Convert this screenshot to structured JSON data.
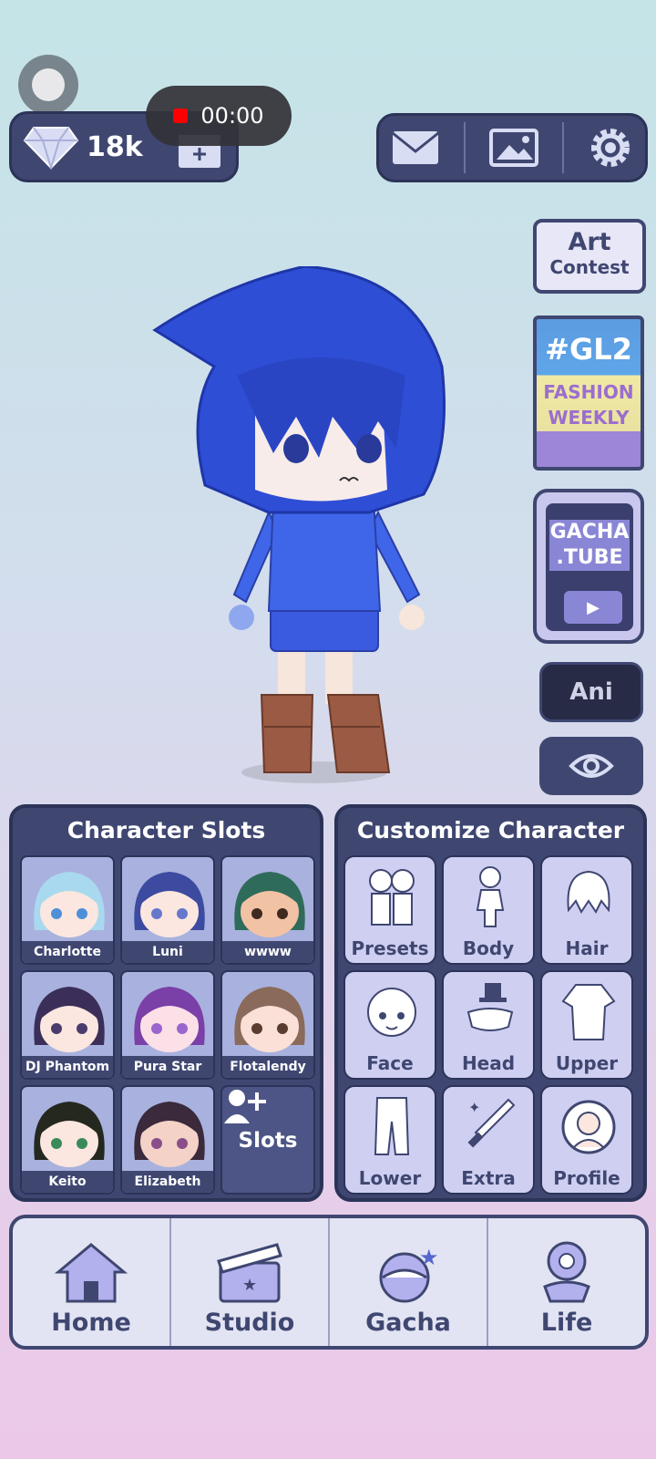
{
  "status": {
    "recording_time": "00:00"
  },
  "currency": {
    "gems": "18k"
  },
  "promos": {
    "art_contest_line1": "Art",
    "art_contest_line2": "Contest",
    "gl2_tag": "#GL2",
    "gl2_line1": "FASHION",
    "gl2_line2": "WEEKLY",
    "gachatube_line1": "GACHA",
    "gachatube_line2": ".TUBE"
  },
  "controls": {
    "ani_label": "Ani"
  },
  "slots_panel": {
    "title": "Character Slots",
    "slots": [
      {
        "name": "Charlotte",
        "hair": "#a9d9ef",
        "skin": "#fbe7df",
        "eyes": "#4f8fd8"
      },
      {
        "name": "Luni",
        "hair": "#3c4aa0",
        "skin": "#fbe7df",
        "eyes": "#6677cc"
      },
      {
        "name": "wwww",
        "hair": "#2f6b5a",
        "skin": "#f2c2a4",
        "eyes": "#3f2a20"
      },
      {
        "name": "DJ Phantom",
        "hair": "#3b2f59",
        "skin": "#fbe7df",
        "eyes": "#4a3b6e"
      },
      {
        "name": "Pura Star",
        "hair": "#7b3fa8",
        "skin": "#fbe0e8",
        "eyes": "#9a65cc"
      },
      {
        "name": "Flotalendy",
        "hair": "#8a6a5a",
        "skin": "#fbe0d8",
        "eyes": "#5a3c30"
      },
      {
        "name": "Keito",
        "hair": "#24281f",
        "skin": "#fbe7df",
        "eyes": "#3a8a5a"
      },
      {
        "name": "Elizabeth",
        "hair": "#3a2a3c",
        "skin": "#f4d2c8",
        "eyes": "#8a4f8a"
      }
    ],
    "add_label": "Slots"
  },
  "customize_panel": {
    "title": "Customize Character",
    "buttons": [
      "Presets",
      "Body",
      "Hair",
      "Face",
      "Head",
      "Upper",
      "Lower",
      "Extra",
      "Profile"
    ]
  },
  "bottom_nav": [
    "Home",
    "Studio",
    "Gacha",
    "Life"
  ]
}
